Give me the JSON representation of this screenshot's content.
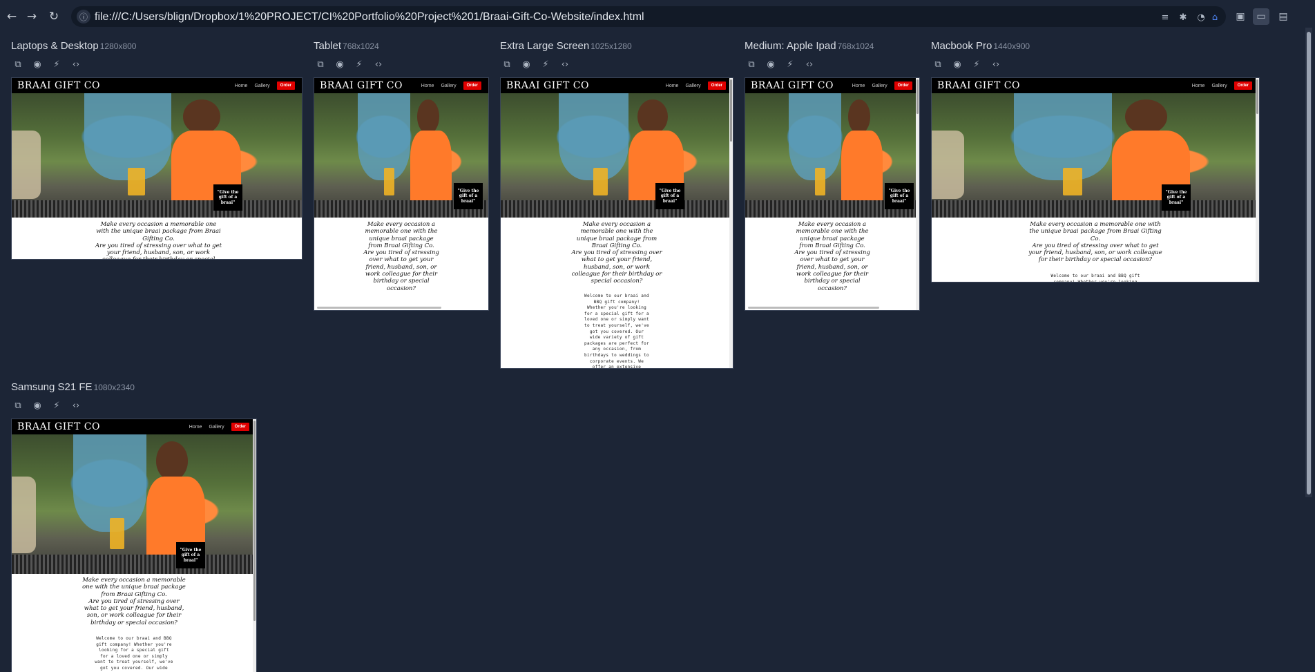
{
  "browser": {
    "url": "file:///C:/Users/blign/Dropbox/1%20PROJECT/CI%20Portfolio%20Project%201/Braai-Gift-Co-Website/index.html",
    "back_icon": "back-arrow-icon",
    "forward_icon": "forward-arrow-icon",
    "reload_icon": "reload-icon"
  },
  "site": {
    "brand": "BRAAI GIFT CO",
    "nav_home": "Home",
    "nav_gallery": "Gallery",
    "nav_order": "Order",
    "quote": "\"Give the gift of a braai\"",
    "lead": "Make every occasion a memorable one with the unique braai package from Braai Gifting Co.",
    "question": "Are you tired of stressing over what to get your friend, husband, son, or work colleague for their birthday or special occasion?",
    "welcome": "Welcome to our braai and BBQ gift company! Whether you're looking for a special gift for a loved one or simply want to treat yourself, we've got you covered. Our wide variety of gift packages are perfect for any occasion, from birthdays to weddings to corporate events. We offer an extensive"
  },
  "devices": [
    {
      "name": "Laptops & Desktop",
      "res": "1280x800"
    },
    {
      "name": "Tablet",
      "res": "768x1024"
    },
    {
      "name": "Extra Large Screen",
      "res": "1025x1280"
    },
    {
      "name": "Medium: Apple Ipad",
      "res": "768x1024"
    },
    {
      "name": "Macbook Pro",
      "res": "1440x900"
    },
    {
      "name": "Samsung S21 FE",
      "res": "1080x2340"
    }
  ],
  "colors": {
    "background": "#1c2536",
    "nav": "#000000",
    "order_button": "#e00000"
  }
}
